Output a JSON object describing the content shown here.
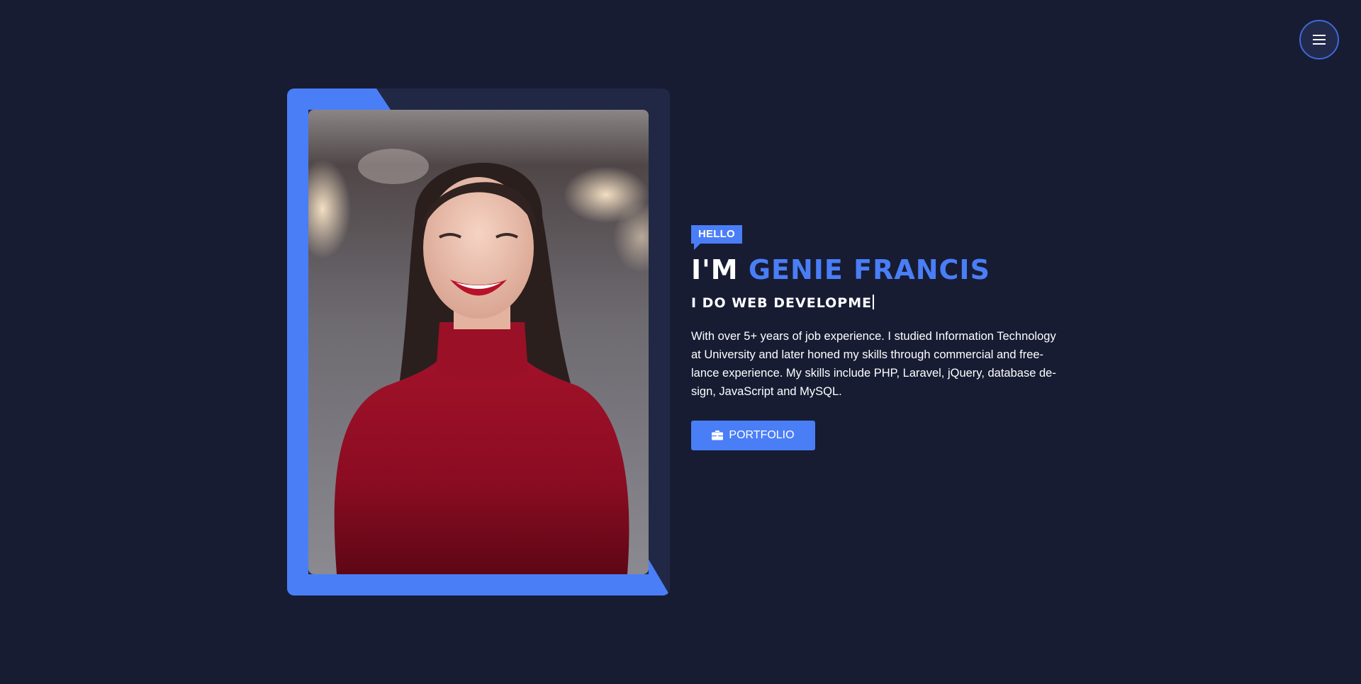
{
  "menu": {
    "icon": "hamburger-menu-icon"
  },
  "hero": {
    "badge": "HELLO",
    "title_prefix": "I'M",
    "name": "GENIE FRANCIS",
    "typed_text": "I DO WEB DEVELOPME",
    "bio": "With over 5+ years of job experience. I studied Information Technology at University and later honed my skills through commercial and free-lance experience. My skills include PHP, Laravel, jQuery, database de-sign, JavaScript and MySQL.",
    "button_label": "PORTFOLIO",
    "button_icon": "briefcase-icon"
  },
  "colors": {
    "background": "#171c33",
    "card": "#212846",
    "accent": "#4a7ef7"
  }
}
